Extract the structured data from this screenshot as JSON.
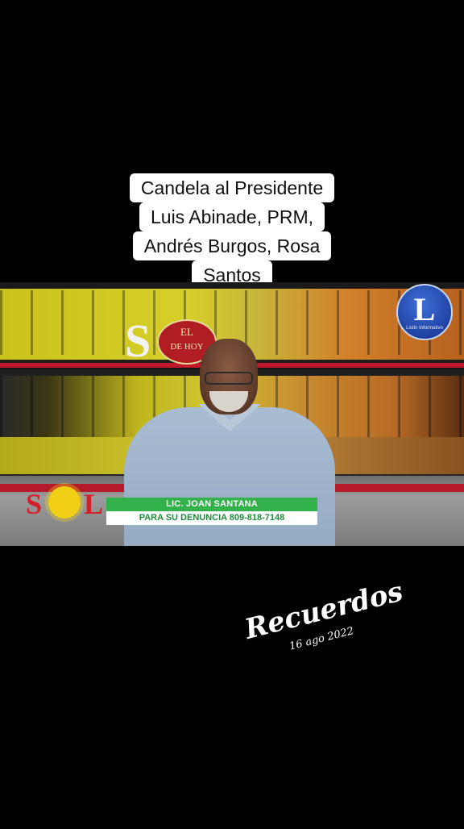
{
  "caption": {
    "lines": [
      "Candela al Presidente",
      "Luis Abinade, PRM,",
      "Andrés Burgos, Rosa",
      "Santos"
    ]
  },
  "studio_logo": {
    "big_letter": "S",
    "oval_line1": "EL",
    "oval_line2": "DE HOY"
  },
  "lower_third": {
    "name": "LIC. JOAN SANTANA",
    "subtitle": "PARA SU DENUNCIA 809-818-7148",
    "logo_left": "S",
    "logo_right": "L",
    "accent_green": "#33b14a"
  },
  "corner_badge": {
    "letter": "L",
    "sub": "Listín Informativo"
  },
  "overlay": {
    "title": "Recuerdos",
    "date": "16 ago 2022"
  }
}
